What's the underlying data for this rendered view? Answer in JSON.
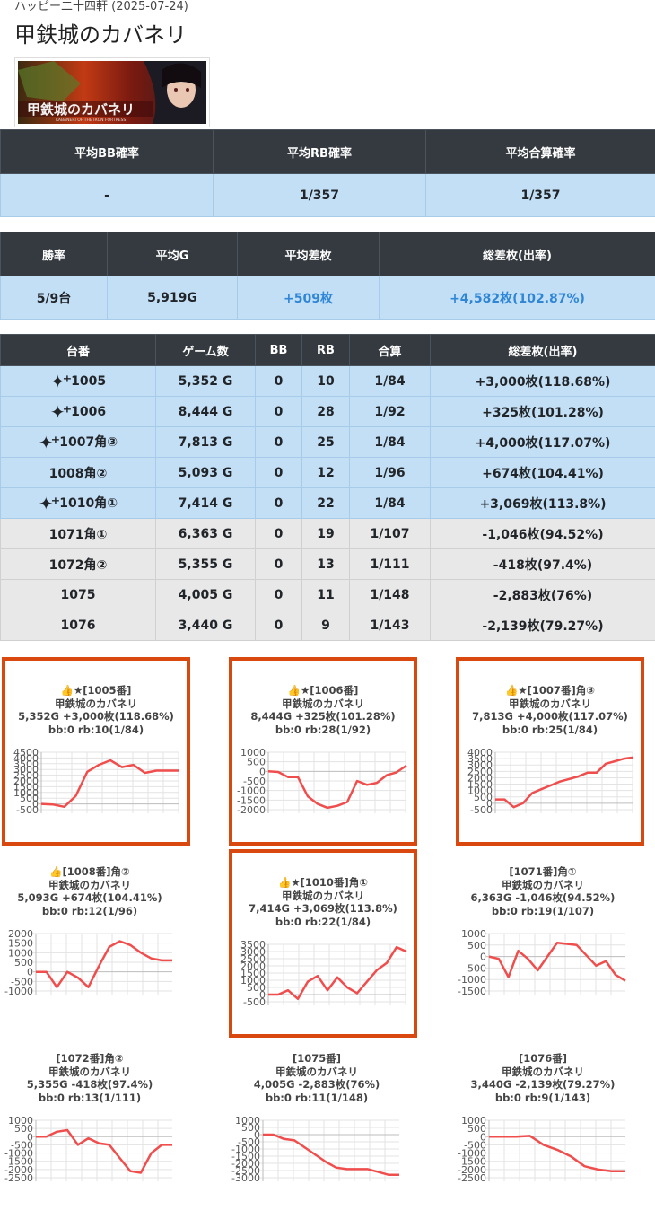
{
  "header": {
    "subtitle": "ハッピー二十四軒 (2025-07-24)",
    "title": "甲鉄城のカバネリ",
    "banner_text": "甲鉄城のカバネリ",
    "banner_sub": "KABANERI OF THE IRON FORTRESS"
  },
  "summary1": {
    "headers": [
      "平均BB確率",
      "平均RB確率",
      "平均合算確率"
    ],
    "values": [
      "-",
      "1/357",
      "1/357"
    ]
  },
  "summary2": {
    "headers": [
      "勝率",
      "平均G",
      "平均差枚",
      "総差枚(出率)"
    ],
    "values": [
      "5/9台",
      "5,919G",
      "+509枚",
      "+4,582枚(102.87%)"
    ]
  },
  "machines": {
    "headers": [
      "台番",
      "ゲーム数",
      "BB",
      "RB",
      "合算",
      "総差枚(出率)"
    ],
    "rows": [
      {
        "no": "1005",
        "star": true,
        "games": "5,352 G",
        "bb": "0",
        "rb": "10",
        "total": "1/84",
        "diff": "+3,000枚(118.68%)",
        "win": true
      },
      {
        "no": "1006",
        "star": true,
        "games": "8,444 G",
        "bb": "0",
        "rb": "28",
        "total": "1/92",
        "diff": "+325枚(101.28%)",
        "win": true
      },
      {
        "no": "1007角③",
        "star": true,
        "games": "7,813 G",
        "bb": "0",
        "rb": "25",
        "total": "1/84",
        "diff": "+4,000枚(117.07%)",
        "win": true
      },
      {
        "no": "1008角②",
        "star": false,
        "games": "5,093 G",
        "bb": "0",
        "rb": "12",
        "total": "1/96",
        "diff": "+674枚(104.41%)",
        "win": true
      },
      {
        "no": "1010角①",
        "star": true,
        "games": "7,414 G",
        "bb": "0",
        "rb": "22",
        "total": "1/84",
        "diff": "+3,069枚(113.8%)",
        "win": true
      },
      {
        "no": "1071角①",
        "star": false,
        "games": "6,363 G",
        "bb": "0",
        "rb": "19",
        "total": "1/107",
        "diff": "-1,046枚(94.52%)",
        "win": false
      },
      {
        "no": "1072角②",
        "star": false,
        "games": "5,355 G",
        "bb": "0",
        "rb": "13",
        "total": "1/111",
        "diff": "-418枚(97.4%)",
        "win": false
      },
      {
        "no": "1075",
        "star": false,
        "games": "4,005 G",
        "bb": "0",
        "rb": "11",
        "total": "1/148",
        "diff": "-2,883枚(76%)",
        "win": false
      },
      {
        "no": "1076",
        "star": false,
        "games": "3,440 G",
        "bb": "0",
        "rb": "9",
        "total": "1/143",
        "diff": "-2,139枚(79.27%)",
        "win": false
      }
    ]
  },
  "line_color": "#f04d4d",
  "chart_data": [
    {
      "type": "line",
      "lines": [
        "👍★[1005番]",
        "甲鉄城のカバネリ",
        "5,352G +3,000枚(118.68%)",
        "bb:0 rb:10(1/84)"
      ],
      "ylim": [
        -500,
        4500
      ],
      "ticks": [
        "4500",
        "4000",
        "3500",
        "3000",
        "2500",
        "2000",
        "1500",
        "1000",
        "500",
        "0",
        "-500"
      ],
      "values": [
        0,
        -50,
        -250,
        700,
        2800,
        3400,
        3800,
        3200,
        3400,
        2700,
        2900,
        2900,
        2900
      ]
    },
    {
      "type": "line",
      "lines": [
        "👍★[1006番]",
        "甲鉄城のカバネリ",
        "8,444G +325枚(101.28%)",
        "bb:0 rb:28(1/92)"
      ],
      "ylim": [
        -2000,
        1000
      ],
      "ticks": [
        "1000",
        "500",
        "0",
        "-500",
        "-1000",
        "-1500",
        "-2000"
      ],
      "values": [
        0,
        -30,
        -300,
        -300,
        -1300,
        -1700,
        -1900,
        -1800,
        -1600,
        -500,
        -700,
        -600,
        -200,
        -50,
        300
      ]
    },
    {
      "type": "line",
      "lines": [
        "👍★[1007番]角③",
        "甲鉄城のカバネリ",
        "7,813G +4,000枚(117.07%)",
        "bb:0 rb:25(1/84)"
      ],
      "ylim": [
        -500,
        4000
      ],
      "ticks": [
        "4000",
        "3500",
        "3000",
        "2500",
        "2000",
        "1500",
        "1000",
        "500",
        "0",
        "-500"
      ],
      "values": [
        300,
        300,
        -300,
        0,
        800,
        1100,
        1400,
        1700,
        1900,
        2100,
        2400,
        2400,
        3100,
        3300,
        3500,
        3600
      ]
    },
    {
      "type": "line",
      "lines": [
        "👍[1008番]角②",
        "甲鉄城のカバネリ",
        "5,093G +674枚(104.41%)",
        "bb:0 rb:12(1/96)"
      ],
      "ylim": [
        -1000,
        2000
      ],
      "ticks": [
        "2000",
        "1500",
        "1000",
        "500",
        "0",
        "-500",
        "-1000"
      ],
      "values": [
        0,
        0,
        -800,
        0,
        -300,
        -800,
        300,
        1300,
        1600,
        1400,
        1000,
        700,
        600,
        600
      ]
    },
    {
      "type": "line",
      "lines": [
        "👍★[1010番]角①",
        "甲鉄城のカバネリ",
        "7,414G +3,069枚(113.8%)",
        "bb:0 rb:22(1/84)"
      ],
      "ylim": [
        -500,
        3500
      ],
      "ticks": [
        "3500",
        "3000",
        "2500",
        "2000",
        "1500",
        "1000",
        "500",
        "0",
        "-500"
      ],
      "values": [
        0,
        0,
        300,
        -300,
        900,
        1300,
        300,
        1200,
        500,
        100,
        900,
        1700,
        2200,
        3300,
        3000
      ]
    },
    {
      "type": "line",
      "lines": [
        "[1071番]角①",
        "甲鉄城のカバネリ",
        "6,363G -1,046枚(94.52%)",
        "bb:0 rb:19(1/107)"
      ],
      "ylim": [
        -1500,
        1000
      ],
      "ticks": [
        "1000",
        "500",
        "0",
        "-500",
        "-1000",
        "-1500"
      ],
      "values": [
        0,
        -100,
        -900,
        250,
        -100,
        -600,
        0,
        600,
        550,
        500,
        50,
        -400,
        -200,
        -800,
        -1050
      ]
    },
    {
      "type": "line",
      "lines": [
        "[1072番]角②",
        "甲鉄城のカバネリ",
        "5,355G -418枚(97.4%)",
        "bb:0 rb:13(1/111)"
      ],
      "ylim": [
        -2500,
        1000
      ],
      "ticks": [
        "1000",
        "500",
        "0",
        "-500",
        "-1000",
        "-1500",
        "-2000",
        "-2500"
      ],
      "values": [
        0,
        0,
        300,
        400,
        -500,
        -100,
        -400,
        -500,
        -1300,
        -2100,
        -2200,
        -1000,
        -500,
        -500
      ]
    },
    {
      "type": "line",
      "lines": [
        "[1075番]",
        "甲鉄城のカバネリ",
        "4,005G -2,883枚(76%)",
        "bb:0 rb:11(1/148)"
      ],
      "ylim": [
        -3000,
        1000
      ],
      "ticks": [
        "1000",
        "500",
        "0",
        "-500",
        "-1000",
        "-1500",
        "-2000",
        "-2500",
        "-3000"
      ],
      "values": [
        0,
        0,
        -300,
        -400,
        -900,
        -1400,
        -1900,
        -2300,
        -2400,
        -2400,
        -2400,
        -2600,
        -2800,
        -2800
      ]
    },
    {
      "type": "line",
      "lines": [
        "[1076番]",
        "甲鉄城のカバネリ",
        "3,440G -2,139枚(79.27%)",
        "bb:0 rb:9(1/143)"
      ],
      "ylim": [
        -2500,
        1000
      ],
      "ticks": [
        "1000",
        "500",
        "0",
        "-500",
        "-1000",
        "-1500",
        "-2000",
        "-2500"
      ],
      "values": [
        0,
        0,
        0,
        50,
        -500,
        -800,
        -1200,
        -1800,
        -2000,
        -2100,
        -2100
      ]
    }
  ]
}
